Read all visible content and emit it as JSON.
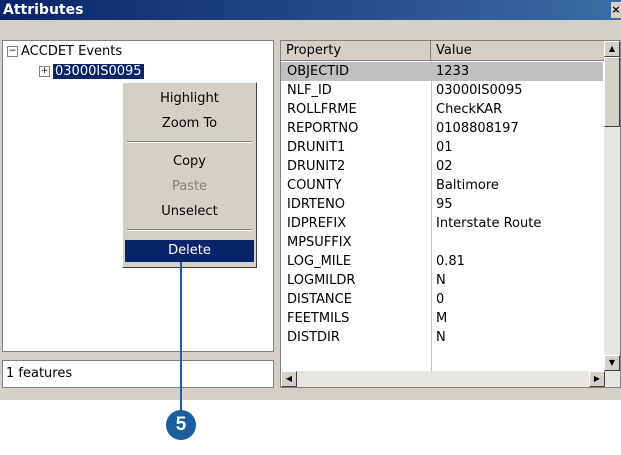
{
  "window": {
    "title": "Attributes",
    "close_glyph": "×"
  },
  "tree": {
    "root_toggle": "−",
    "root_label": "ACCDET Events",
    "child_toggle": "+",
    "child_label": "03000IS0095"
  },
  "status": {
    "features": "1 features"
  },
  "grid": {
    "headers": {
      "property": "Property",
      "value": "Value"
    },
    "rows": [
      {
        "property": "OBJECTID",
        "value": "1233"
      },
      {
        "property": "NLF_ID",
        "value": "03000IS0095"
      },
      {
        "property": "ROLLFRME",
        "value": "CheckKAR"
      },
      {
        "property": "REPORTNO",
        "value": "0108808197"
      },
      {
        "property": "DRUNIT1",
        "value": "01"
      },
      {
        "property": "DRUNIT2",
        "value": "02"
      },
      {
        "property": "COUNTY",
        "value": "Baltimore"
      },
      {
        "property": "IDRTENO",
        "value": "95"
      },
      {
        "property": "IDPREFIX",
        "value": "Interstate Route"
      },
      {
        "property": "MPSUFFIX",
        "value": ""
      },
      {
        "property": "LOG_MILE",
        "value": "0.81"
      },
      {
        "property": "LOGMILDR",
        "value": "N"
      },
      {
        "property": "DISTANCE",
        "value": "0"
      },
      {
        "property": "FEETMILS",
        "value": "M"
      },
      {
        "property": "DISTDIR",
        "value": "N"
      }
    ],
    "scroll_up_glyph": "▲",
    "scroll_down_glyph": "▼",
    "scroll_left_glyph": "◀",
    "scroll_right_glyph": "▶"
  },
  "context_menu": {
    "highlight": "Highlight",
    "zoom_to": "Zoom To",
    "copy": "Copy",
    "paste": "Paste",
    "unselect": "Unselect",
    "delete": "Delete"
  },
  "callout": {
    "number": "5",
    "color": "#1b5f9e"
  }
}
